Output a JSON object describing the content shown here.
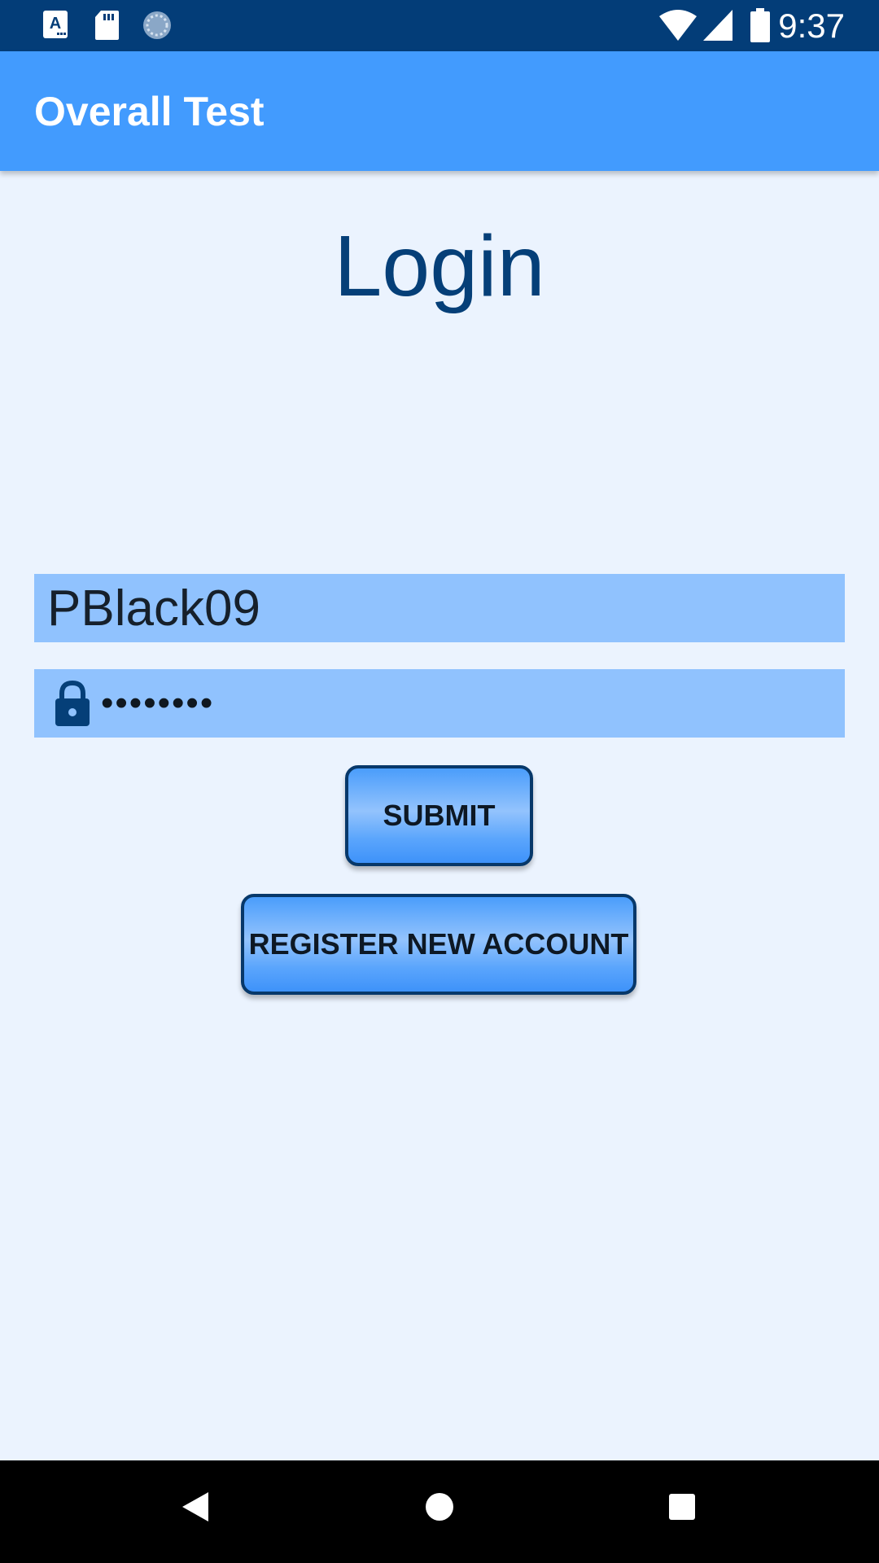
{
  "status_bar": {
    "time": "9:37",
    "left_icons": [
      "font-app-icon",
      "sd-card-icon",
      "sync-circle-icon"
    ],
    "right_icons": [
      "wifi-icon",
      "signal-icon",
      "battery-icon"
    ]
  },
  "app_bar": {
    "title": "Overall Test"
  },
  "login": {
    "title": "Login",
    "username_value": "PBlack09",
    "password_masked": "••••••••",
    "password_icon": "lock-icon",
    "submit_label": "SUBMIT",
    "register_label": "REGISTER NEW ACCOUNT"
  },
  "nav_bar": {
    "buttons": [
      "back-icon",
      "home-icon",
      "recents-icon"
    ]
  },
  "colors": {
    "status_bar_bg": "#033d78",
    "app_bar_bg": "#429bfe",
    "screen_bg": "#ebf3fe",
    "field_bg": "#90c2fe",
    "title_color": "#053f78",
    "button_border": "#07386a"
  }
}
